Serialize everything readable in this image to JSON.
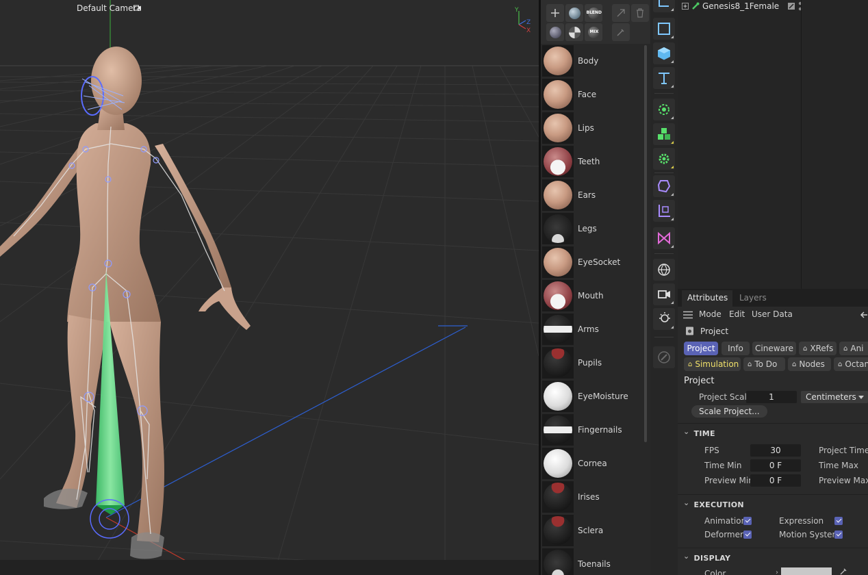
{
  "viewport": {
    "camera_label": "Default Camera",
    "axis": {
      "y": "Y",
      "z": "Z",
      "x": "X"
    }
  },
  "materials": {
    "toolbar": {
      "add_icon": "plus-icon",
      "blend_label": "BLEND",
      "mix_label": "MIX"
    },
    "items": [
      {
        "name": "Body",
        "preview": "skin"
      },
      {
        "name": "Face",
        "preview": "skin"
      },
      {
        "name": "Lips",
        "preview": "skin"
      },
      {
        "name": "Teeth",
        "preview": "teeth"
      },
      {
        "name": "Ears",
        "preview": "skin"
      },
      {
        "name": "Legs",
        "preview": "dark-drop"
      },
      {
        "name": "EyeSocket",
        "preview": "skin"
      },
      {
        "name": "Mouth",
        "preview": "teeth"
      },
      {
        "name": "Arms",
        "preview": "band"
      },
      {
        "name": "Pupils",
        "preview": "dark-red"
      },
      {
        "name": "EyeMoisture",
        "preview": "white"
      },
      {
        "name": "Fingernails",
        "preview": "band"
      },
      {
        "name": "Cornea",
        "preview": "white"
      },
      {
        "name": "Irises",
        "preview": "dark-red"
      },
      {
        "name": "Sclera",
        "preview": "dark-red"
      },
      {
        "name": "Toenails",
        "preview": "dark-drop"
      }
    ]
  },
  "objects": {
    "root": {
      "name": "Genesis8_1Female"
    }
  },
  "attributes": {
    "tabs": {
      "attributes": "Attributes",
      "layers": "Layers"
    },
    "menu": {
      "mode": "Mode",
      "edit": "Edit",
      "user_data": "User Data"
    },
    "object_title": "Project",
    "chips_row1": {
      "project": "Project",
      "info": "Info",
      "cineware": "Cineware",
      "xrefs": "XRefs",
      "anim": "Ani"
    },
    "chips_row2": {
      "simulation": "Simulation",
      "todo": "To Do",
      "nodes": "Nodes",
      "octane": "Octan"
    },
    "section_title": "Project",
    "project_scale": {
      "label": "Project Scale",
      "value": "1",
      "unit": "Centimeters"
    },
    "scale_button": "Scale Project...",
    "time": {
      "title": "TIME",
      "fps": {
        "label": "FPS",
        "value": "30"
      },
      "project_time": {
        "label": "Project Time"
      },
      "time_min": {
        "label": "Time Min",
        "value": "0 F"
      },
      "time_max": {
        "label": "Time Max"
      },
      "preview_min": {
        "label": "Preview Min",
        "value": "0 F"
      },
      "preview_max": {
        "label": "Preview Max"
      }
    },
    "execution": {
      "title": "EXECUTION",
      "animation": {
        "label": "Animation",
        "checked": true
      },
      "expression": {
        "label": "Expression",
        "checked": true
      },
      "deformers": {
        "label": "Deformers",
        "checked": true
      },
      "motion_system": {
        "label": "Motion System",
        "checked": true
      }
    },
    "display": {
      "title": "DISPLAY",
      "color": {
        "label": "Color"
      }
    }
  }
}
